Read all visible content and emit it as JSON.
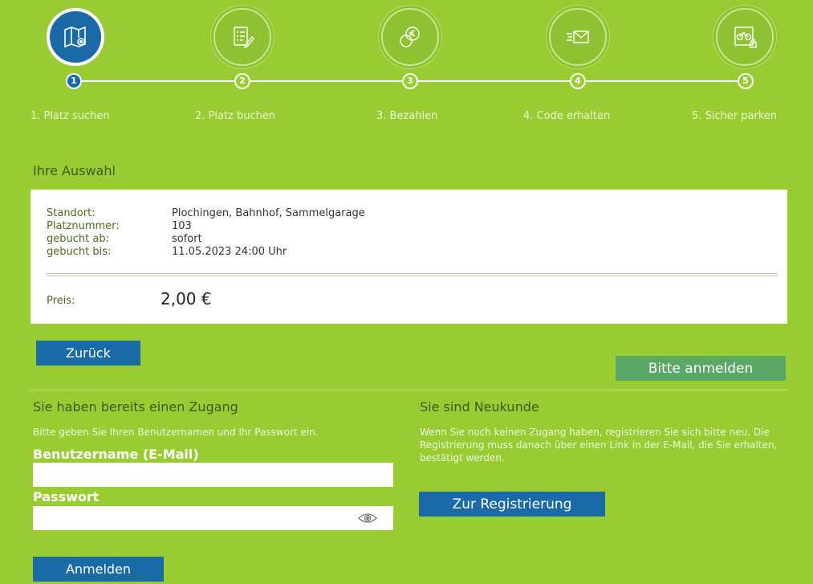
{
  "steps": [
    {
      "num": "1",
      "label": "1. Platz suchen",
      "icon": "map-pin-icon",
      "active": true
    },
    {
      "num": "2",
      "label": "2. Platz buchen",
      "icon": "checklist-pen-icon",
      "active": false
    },
    {
      "num": "3",
      "label": "3. Bezahlen",
      "icon": "euro-coins-icon",
      "active": false
    },
    {
      "num": "4",
      "label": "4. Code erhalten",
      "icon": "mail-icon",
      "active": false
    },
    {
      "num": "5",
      "label": "5. Sicher parken",
      "icon": "bike-lock-icon",
      "active": false
    }
  ],
  "selection": {
    "title": "Ihre Auswahl",
    "rows": [
      {
        "label": "Standort:",
        "value": "Plochingen, Bahnhof, Sammelgarage"
      },
      {
        "label": "Platznummer:",
        "value": "103"
      },
      {
        "label": "gebucht ab:",
        "value": "sofort"
      },
      {
        "label": "gebucht bis:",
        "value": "11.05.2023 24:00 Uhr"
      }
    ],
    "price_label": "Preis:",
    "price": "2,00 €"
  },
  "actions": {
    "back_label": "Zurück",
    "login_prompt_label": "Bitte anmelden"
  },
  "login": {
    "title": "Sie haben bereits einen Zugang",
    "hint": "Bitte geben Sie Ihren Benutzernamen und Ihr Passwort ein.",
    "username_label": "Benutzername (E-Mail)",
    "username_value": "",
    "password_label": "Passwort",
    "password_value": "",
    "submit_label": "Anmelden"
  },
  "register": {
    "title": "Sie sind Neukunde",
    "hint": "Wenn Sie noch keinen Zugang haben, registrieren Sie sich bitte neu. Die Registrierung muss danach über einen Link in der E-Mail, die Sie erhalten, bestätigt werden.",
    "button_label": "Zur Registrierung"
  },
  "colors": {
    "page_bg": "#99cc33",
    "primary": "#1a6aa8",
    "muted_button": "#5aa766"
  }
}
